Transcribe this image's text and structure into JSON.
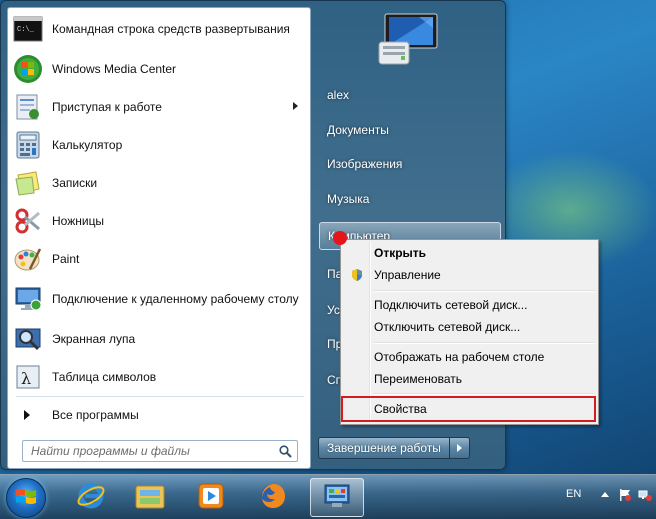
{
  "start_menu": {
    "programs": [
      {
        "label": "Командная строка средств развертывания",
        "icon": "cmd-icon",
        "has_submenu": false
      },
      {
        "label": "Windows Media Center",
        "icon": "media-center-icon",
        "has_submenu": false
      },
      {
        "label": "Приступая к работе",
        "icon": "getting-started-icon",
        "has_submenu": true
      },
      {
        "label": "Калькулятор",
        "icon": "calculator-icon",
        "has_submenu": false
      },
      {
        "label": "Записки",
        "icon": "sticky-notes-icon",
        "has_submenu": false
      },
      {
        "label": "Ножницы",
        "icon": "scissors-icon",
        "has_submenu": false
      },
      {
        "label": "Paint",
        "icon": "paint-icon",
        "has_submenu": false
      },
      {
        "label": "Подключение к удаленному рабочему столу",
        "icon": "remote-desktop-icon",
        "has_submenu": false
      },
      {
        "label": "Экранная лупа",
        "icon": "magnifier-icon",
        "has_submenu": false
      },
      {
        "label": "Таблица символов",
        "icon": "charmap-icon",
        "has_submenu": false
      }
    ],
    "all_programs": "Все программы",
    "search_placeholder": "Найти программы и файлы",
    "right_items": [
      {
        "label": "alex"
      },
      {
        "label": "Документы"
      },
      {
        "label": "Изображения"
      },
      {
        "label": "Музыка"
      },
      {
        "label": "Компьютер"
      },
      {
        "label": "Па"
      },
      {
        "label": "Ус"
      },
      {
        "label": "Пр"
      },
      {
        "label": "Сп"
      }
    ],
    "shutdown_label": "Завершение работы"
  },
  "context_menu": {
    "items": [
      {
        "label": "Открыть",
        "bold": true
      },
      {
        "label": "Управление",
        "bold": false,
        "icon": "uac-shield-icon"
      },
      {
        "label": "Подключить сетевой диск...",
        "bold": false
      },
      {
        "label": "Отключить сетевой диск...",
        "bold": false
      },
      {
        "label": "Отображать на рабочем столе",
        "bold": false
      },
      {
        "label": "Переименовать",
        "bold": false
      },
      {
        "label": "Свойства",
        "bold": false,
        "highlighted": true
      }
    ],
    "highlight_color": "#d21e1e"
  },
  "taskbar": {
    "pinned": [
      "windows-start-icon",
      "internet-explorer-icon",
      "explorer-icon",
      "media-player-icon",
      "firefox-icon",
      "control-panel-icon"
    ],
    "active": "control-panel-icon",
    "language": "EN"
  }
}
